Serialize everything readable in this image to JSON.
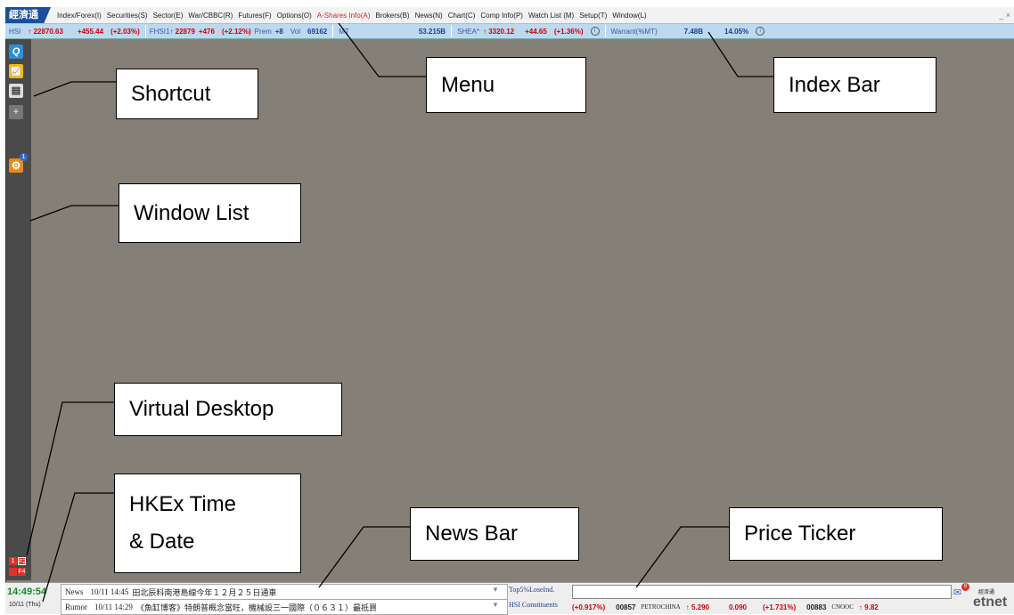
{
  "app": {
    "logo": "經濟通"
  },
  "menu": [
    "Index/Forex(I)",
    "Securities(S)",
    "Sector(E)",
    "War/CBBC(R)",
    "Futures(F)",
    "Options(O)",
    "A-Shares Info(A)",
    "Brokers(B)",
    "News(N)",
    "Chart(C)",
    "Comp Info(P)",
    "Watch List (M)",
    "Setup(T)",
    "Window(L)"
  ],
  "window_controls": "_ ×",
  "index_bar": {
    "hsi_label": "HSI",
    "hsi_value": "↑ 22870.63",
    "hsi_change": "+455.44",
    "hsi_pct": "(+2.03%)",
    "fhsi_label": "FHSI1",
    "fhsi_value": "↑ 22879",
    "fhsi_change": "+476",
    "fhsi_pct": "(+2.12%)",
    "prem_label": "Prem",
    "prem_value": "+8",
    "vol_label": "Vol",
    "vol_value": "69162",
    "mt_label": "MT",
    "mt_value": "53.215B",
    "shea_label": "SHEA*",
    "shea_value": "↑ 3320.12",
    "shea_change": "+44.65",
    "shea_pct": "(+1.36%)",
    "warrant_label": "Warrant(%MT)",
    "warrant_value": "7.48B",
    "warrant_pct": "14.05%"
  },
  "shortcuts": {
    "quote": "Q",
    "chart": "📈",
    "news": "▤",
    "add": "+",
    "settings_badge": "1"
  },
  "virtual_desktop": [
    "1",
    "F2",
    "",
    "F4"
  ],
  "clock": {
    "time": "14:49:54",
    "date": "10/11 (Thu)"
  },
  "news_bar": {
    "news_label": "News",
    "news_time": "10/11 14:45",
    "news_text": "田北辰料南港島線今年１２月２５日通車",
    "rumor_label": "Rumor",
    "rumor_time": "10/11 14:29",
    "rumor_text": "《魚缸博客》特朗普概念當旺，機械設三一國際（０６３１）最抵買"
  },
  "dropdowns": {
    "top": "Top5%LoseInd.",
    "bottom": "HSI Constituents"
  },
  "ticker": [
    "(+0.917%)",
    "00857",
    "PETROCHINA",
    "↑ 5.290",
    "0.090",
    "(+1.731%)",
    "00883",
    "CNOOC",
    "↑ 9.82"
  ],
  "brand": {
    "small": "經濟通",
    "main": "etnet",
    "mail_badge": "8"
  },
  "callouts": {
    "shortcut": "Shortcut",
    "menu": "Menu",
    "index_bar": "Index Bar",
    "window_list": "Window List",
    "virtual_desktop": "Virtual Desktop",
    "hkex_time_1": "HKEx Time",
    "hkex_time_2": "& Date",
    "news_bar": "News Bar",
    "price_ticker": "Price Ticker"
  }
}
